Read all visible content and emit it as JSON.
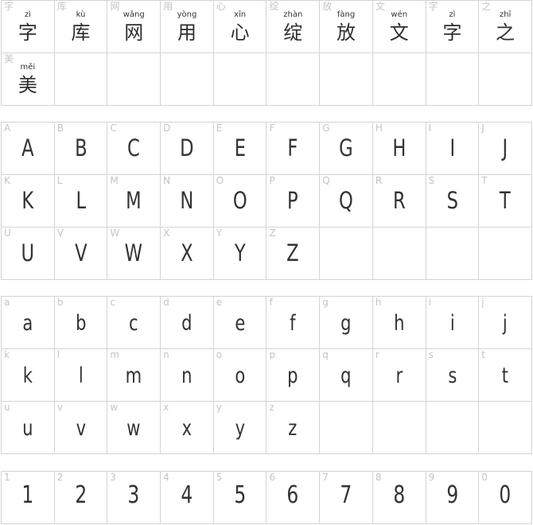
{
  "hanzi": [
    {
      "ref": "字",
      "pinyin": "zì",
      "char": "字"
    },
    {
      "ref": "库",
      "pinyin": "kù",
      "char": "库"
    },
    {
      "ref": "网",
      "pinyin": "wǎng",
      "char": "网"
    },
    {
      "ref": "用",
      "pinyin": "yòng",
      "char": "用"
    },
    {
      "ref": "心",
      "pinyin": "xīn",
      "char": "心"
    },
    {
      "ref": "绽",
      "pinyin": "zhàn",
      "char": "绽"
    },
    {
      "ref": "放",
      "pinyin": "fàng",
      "char": "放"
    },
    {
      "ref": "文",
      "pinyin": "wén",
      "char": "文"
    },
    {
      "ref": "字",
      "pinyin": "zì",
      "char": "字"
    },
    {
      "ref": "之",
      "pinyin": "zhī",
      "char": "之"
    },
    {
      "ref": "美",
      "pinyin": "měi",
      "char": "美"
    }
  ],
  "uppercase": [
    "A",
    "B",
    "C",
    "D",
    "E",
    "F",
    "G",
    "H",
    "I",
    "J",
    "K",
    "L",
    "M",
    "N",
    "O",
    "P",
    "Q",
    "R",
    "S",
    "T",
    "U",
    "V",
    "W",
    "X",
    "Y",
    "Z"
  ],
  "lowercase": [
    "a",
    "b",
    "c",
    "d",
    "e",
    "f",
    "g",
    "h",
    "i",
    "j",
    "k",
    "l",
    "m",
    "n",
    "o",
    "p",
    "q",
    "r",
    "s",
    "t",
    "u",
    "v",
    "w",
    "x",
    "y",
    "z"
  ],
  "digits": [
    "1",
    "2",
    "3",
    "4",
    "5",
    "6",
    "7",
    "8",
    "9",
    "0"
  ]
}
